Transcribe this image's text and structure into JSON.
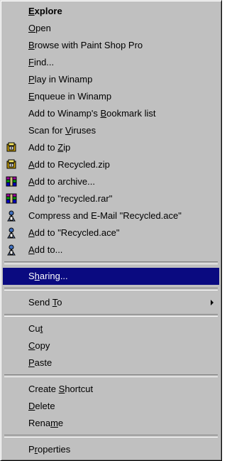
{
  "menu": {
    "items": [
      {
        "id": "explore",
        "pre": "",
        "acc": "E",
        "post": "xplore",
        "bold": true
      },
      {
        "id": "open",
        "pre": "",
        "acc": "O",
        "post": "pen"
      },
      {
        "id": "browse",
        "pre": "",
        "acc": "B",
        "post": "rowse with Paint Shop Pro"
      },
      {
        "id": "find",
        "pre": "",
        "acc": "F",
        "post": "ind..."
      },
      {
        "id": "play-winamp",
        "pre": "",
        "acc": "P",
        "post": "lay in Winamp"
      },
      {
        "id": "enqueue-winamp",
        "pre": "",
        "acc": "E",
        "post": "nqueue in Winamp"
      },
      {
        "id": "winamp-bookmark",
        "pre": "Add to Winamp's ",
        "acc": "B",
        "post": "ookmark list"
      },
      {
        "id": "scan-viruses",
        "pre": "Scan for ",
        "acc": "V",
        "post": "iruses"
      },
      {
        "id": "add-to-zip",
        "pre": "Add to ",
        "acc": "Z",
        "post": "ip",
        "icon": "winzip-icon"
      },
      {
        "id": "add-recycled-zip",
        "pre": "",
        "acc": "A",
        "post": "dd to Recycled.zip",
        "icon": "winzip-icon"
      },
      {
        "id": "add-archive",
        "pre": "",
        "acc": "A",
        "post": "dd to archive...",
        "icon": "winrar-icon"
      },
      {
        "id": "add-recycled-rar",
        "pre": "Add ",
        "acc": "t",
        "post": "o \"recycled.rar\"",
        "icon": "winrar-icon"
      },
      {
        "id": "compress-email-ace",
        "pre": "Compress and E-Mail \"Recycled.ace\"",
        "acc": "",
        "post": "",
        "icon": "winace-icon"
      },
      {
        "id": "add-recycled-ace",
        "pre": "",
        "acc": "A",
        "post": "dd to \"Recycled.ace\"",
        "icon": "winace-icon"
      },
      {
        "id": "add-to",
        "pre": "",
        "acc": "A",
        "post": "dd to...",
        "icon": "winace-icon"
      },
      {
        "separator": true
      },
      {
        "id": "sharing",
        "pre": "S",
        "acc": "h",
        "post": "aring...",
        "selected": true
      },
      {
        "separator": true
      },
      {
        "id": "send-to",
        "pre": "Send ",
        "acc": "T",
        "post": "o",
        "submenu": true
      },
      {
        "separator": true
      },
      {
        "id": "cut",
        "pre": "Cu",
        "acc": "t",
        "post": ""
      },
      {
        "id": "copy",
        "pre": "",
        "acc": "C",
        "post": "opy"
      },
      {
        "id": "paste",
        "pre": "",
        "acc": "P",
        "post": "aste"
      },
      {
        "separator": true
      },
      {
        "id": "create-shortcut",
        "pre": "Create ",
        "acc": "S",
        "post": "hortcut"
      },
      {
        "id": "delete",
        "pre": "",
        "acc": "D",
        "post": "elete"
      },
      {
        "id": "rename",
        "pre": "Rena",
        "acc": "m",
        "post": "e"
      },
      {
        "separator": true
      },
      {
        "id": "properties",
        "pre": "P",
        "acc": "r",
        "post": "operties"
      }
    ]
  },
  "colors": {
    "menu_bg": "#c0c0c0",
    "highlight": "#0a0a80"
  }
}
